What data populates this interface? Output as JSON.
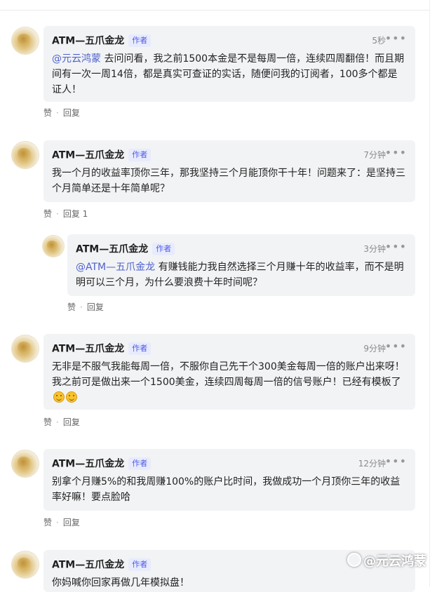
{
  "comments": [
    {
      "author": "ATM—五爪金龙",
      "badge": "作者",
      "time": "5秒",
      "mention": "@元云鸿蒙",
      "text": " 去问问看，我之前1500本金是不是每周一倍，连续四周翻倍！而且期间有一次一周14倍，都是真实可查证的实话，随便问我的订阅者，100多个都是证人！",
      "like": "赞",
      "reply": "回复"
    },
    {
      "author": "ATM—五爪金龙",
      "badge": "作者",
      "time": "7分钟",
      "text": "我一个月的收益率顶你三年，那我坚持三个月能顶你干十年！问题来了：是坚持三个月简单还是十年简单呢？",
      "like": "赞",
      "reply": "回复 1",
      "replies": [
        {
          "author": "ATM—五爪金龙",
          "badge": "作者",
          "time": "3分钟",
          "mention": "@ATM—五爪金龙",
          "text": " 有赚钱能力我自然选择三个月赚十年的收益率，而不是明明可以三个月，为什么要浪费十年时间呢？",
          "like": "赞",
          "reply": "回复"
        }
      ]
    },
    {
      "author": "ATM—五爪金龙",
      "badge": "作者",
      "time": "9分钟",
      "text": "无非是不服气我能每周一倍，不服你自己先干个300美金每周一倍的账户出来呀！我之前可是做出来一个1500美金，连续四周每周一倍的信号账户！已经有模板了",
      "emojis": [
        "smile-emoji",
        "smile-emoji"
      ],
      "like": "赞",
      "reply": "回复"
    },
    {
      "author": "ATM—五爪金龙",
      "badge": "作者",
      "time": "12分钟",
      "text": "别拿个月赚5%的和我周赚100%的账户比时间，我做成功一个月顶你三年的收益率好嘛！要点脸哈",
      "like": "赞",
      "reply": "回复"
    },
    {
      "author": "ATM—五爪金龙",
      "badge": "作者",
      "text": "你妈喊你回家再做几年模拟盘！"
    }
  ],
  "more_icon": "more-dots-icon",
  "watermark": "@元云鸿蒙",
  "colors": {
    "bubble_bg": "#f2f3f5",
    "badge_text": "#4d5be6",
    "badge_bg": "#e8ebfc",
    "mention": "#4d62cc"
  }
}
